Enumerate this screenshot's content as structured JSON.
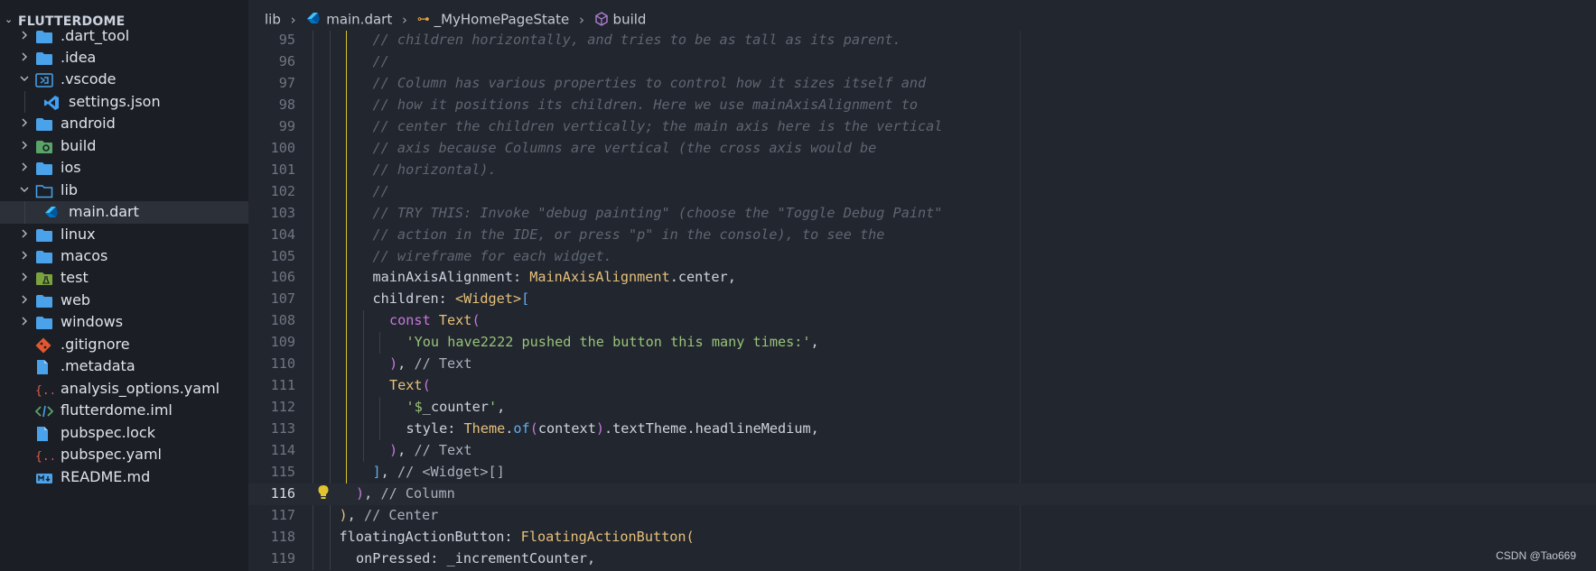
{
  "explorer": {
    "title": "FLUTTERDOME",
    "items": [
      {
        "label": ".dart_tool",
        "type": "folder",
        "expanded": false,
        "indent": 0,
        "icon": "folder-icon"
      },
      {
        "label": ".idea",
        "type": "folder",
        "expanded": false,
        "indent": 0,
        "icon": "folder-icon"
      },
      {
        "label": ".vscode",
        "type": "folder",
        "expanded": true,
        "indent": 0,
        "icon": "vscode-folder-icon"
      },
      {
        "label": "settings.json",
        "type": "file",
        "indent": 1,
        "icon": "vscode-file-icon"
      },
      {
        "label": "android",
        "type": "folder",
        "expanded": false,
        "indent": 0,
        "icon": "folder-icon"
      },
      {
        "label": "build",
        "type": "folder",
        "expanded": false,
        "indent": 0,
        "icon": "build-folder-icon"
      },
      {
        "label": "ios",
        "type": "folder",
        "expanded": false,
        "indent": 0,
        "icon": "folder-icon"
      },
      {
        "label": "lib",
        "type": "folder",
        "expanded": true,
        "indent": 0,
        "icon": "folder-open-icon"
      },
      {
        "label": "main.dart",
        "type": "file",
        "indent": 1,
        "icon": "dart-icon",
        "active": true
      },
      {
        "label": "linux",
        "type": "folder",
        "expanded": false,
        "indent": 0,
        "icon": "folder-icon"
      },
      {
        "label": "macos",
        "type": "folder",
        "expanded": false,
        "indent": 0,
        "icon": "folder-icon"
      },
      {
        "label": "test",
        "type": "folder",
        "expanded": false,
        "indent": 0,
        "icon": "test-folder-icon"
      },
      {
        "label": "web",
        "type": "folder",
        "expanded": false,
        "indent": 0,
        "icon": "folder-icon"
      },
      {
        "label": "windows",
        "type": "folder",
        "expanded": false,
        "indent": 0,
        "icon": "folder-icon"
      },
      {
        "label": ".gitignore",
        "type": "file",
        "indent": 0,
        "icon": "git-icon"
      },
      {
        "label": ".metadata",
        "type": "file",
        "indent": 0,
        "icon": "file-icon"
      },
      {
        "label": "analysis_options.yaml",
        "type": "file",
        "indent": 0,
        "icon": "yaml-icon"
      },
      {
        "label": "flutterdome.iml",
        "type": "file",
        "indent": 0,
        "icon": "code-file-icon"
      },
      {
        "label": "pubspec.lock",
        "type": "file",
        "indent": 0,
        "icon": "file-icon"
      },
      {
        "label": "pubspec.yaml",
        "type": "file",
        "indent": 0,
        "icon": "yaml-icon"
      },
      {
        "label": "README.md",
        "type": "file",
        "indent": 0,
        "icon": "markdown-icon"
      }
    ]
  },
  "breadcrumb": {
    "items": [
      {
        "label": "lib",
        "icon": ""
      },
      {
        "label": "main.dart",
        "icon": "dart-icon"
      },
      {
        "label": "_MyHomePageState",
        "icon": "class-icon"
      },
      {
        "label": "build",
        "icon": "method-icon"
      }
    ]
  },
  "code": {
    "current_line": 116,
    "lines": [
      {
        "n": "95",
        "indent": 3,
        "tokens": [
          [
            "cm",
            "// children horizontally, and tries to be as tall as its parent."
          ]
        ]
      },
      {
        "n": "96",
        "indent": 3,
        "tokens": [
          [
            "cm",
            "//"
          ]
        ]
      },
      {
        "n": "97",
        "indent": 3,
        "tokens": [
          [
            "cm",
            "// Column has various properties to control how it sizes itself and"
          ]
        ]
      },
      {
        "n": "98",
        "indent": 3,
        "tokens": [
          [
            "cm",
            "// how it positions its children. Here we use mainAxisAlignment to"
          ]
        ]
      },
      {
        "n": "99",
        "indent": 3,
        "tokens": [
          [
            "cm",
            "// center the children vertically; the main axis here is the vertical"
          ]
        ]
      },
      {
        "n": "100",
        "indent": 3,
        "tokens": [
          [
            "cm",
            "// axis because Columns are vertical (the cross axis would be"
          ]
        ]
      },
      {
        "n": "101",
        "indent": 3,
        "tokens": [
          [
            "cm",
            "// horizontal)."
          ]
        ]
      },
      {
        "n": "102",
        "indent": 3,
        "tokens": [
          [
            "cm",
            "//"
          ]
        ]
      },
      {
        "n": "103",
        "indent": 3,
        "tokens": [
          [
            "cm",
            "// TRY THIS: Invoke \"debug painting\" (choose the \"Toggle Debug Paint\""
          ]
        ]
      },
      {
        "n": "104",
        "indent": 3,
        "tokens": [
          [
            "cm",
            "// action in the IDE, or press \"p\" in the console), to see the"
          ]
        ]
      },
      {
        "n": "105",
        "indent": 3,
        "tokens": [
          [
            "cm",
            "// wireframe for each widget."
          ]
        ]
      },
      {
        "n": "106",
        "indent": 3,
        "tokens": [
          [
            "pl",
            "mainAxisAlignment: "
          ],
          [
            "cls",
            "MainAxisAlignment"
          ],
          [
            "pl",
            ".center,"
          ]
        ]
      },
      {
        "n": "107",
        "indent": 3,
        "tokens": [
          [
            "pl",
            "children: "
          ],
          [
            "cls",
            "<Widget>"
          ],
          [
            "fn",
            "["
          ]
        ]
      },
      {
        "n": "108",
        "indent": 4,
        "tokens": [
          [
            "kw",
            "const "
          ],
          [
            "cls",
            "Text"
          ],
          [
            "kw",
            "("
          ]
        ]
      },
      {
        "n": "109",
        "indent": 5,
        "tokens": [
          [
            "str",
            "'You have2222 pushed the button this many times:'"
          ],
          [
            "pl",
            ","
          ]
        ]
      },
      {
        "n": "110",
        "indent": 4,
        "tokens": [
          [
            "kw",
            ")"
          ],
          [
            "pl",
            ", "
          ],
          [
            "cm2",
            "// Text"
          ]
        ]
      },
      {
        "n": "111",
        "indent": 4,
        "tokens": [
          [
            "cls",
            "Text"
          ],
          [
            "kw",
            "("
          ]
        ]
      },
      {
        "n": "112",
        "indent": 5,
        "tokens": [
          [
            "str",
            "'$"
          ],
          [
            "pl",
            "_counter"
          ],
          [
            "str",
            "'"
          ],
          [
            "pl",
            ","
          ]
        ]
      },
      {
        "n": "113",
        "indent": 5,
        "tokens": [
          [
            "pl",
            "style: "
          ],
          [
            "cls",
            "Theme"
          ],
          [
            "pl",
            "."
          ],
          [
            "fn",
            "of"
          ],
          [
            "kw",
            "("
          ],
          [
            "pl",
            "context"
          ],
          [
            "kw",
            ")"
          ],
          [
            "pl",
            ".textTheme.headlineMedium,"
          ]
        ]
      },
      {
        "n": "114",
        "indent": 4,
        "tokens": [
          [
            "kw",
            ")"
          ],
          [
            "pl",
            ", "
          ],
          [
            "cm2",
            "// Text"
          ]
        ]
      },
      {
        "n": "115",
        "indent": 3,
        "tokens": [
          [
            "fn",
            "]"
          ],
          [
            "pl",
            ", "
          ],
          [
            "cm2",
            "// <Widget>[]"
          ]
        ]
      },
      {
        "n": "116",
        "indent": 2,
        "tokens": [
          [
            "kw",
            ")"
          ],
          [
            "pl",
            ", "
          ],
          [
            "cm2",
            "// Column"
          ]
        ]
      },
      {
        "n": "117",
        "indent": 1,
        "tokens": [
          [
            "cls",
            ")"
          ],
          [
            "pl",
            ", "
          ],
          [
            "cm2",
            "// Center"
          ]
        ]
      },
      {
        "n": "118",
        "indent": 1,
        "tokens": [
          [
            "pl",
            "floatingActionButton: "
          ],
          [
            "cls",
            "FloatingActionButton"
          ],
          [
            "cls",
            "("
          ]
        ]
      },
      {
        "n": "119",
        "indent": 2,
        "tokens": [
          [
            "pl",
            "onPressed: _incrementCounter,"
          ]
        ]
      }
    ]
  },
  "colors": {
    "comment": "#5f6672",
    "class": "#e5c07b",
    "keyword": "#c678dd",
    "string": "#98c379",
    "function": "#61afef",
    "text": "#cdd3de",
    "guide_yellow": "#d9c32a"
  },
  "watermark": "CSDN @Tao669"
}
